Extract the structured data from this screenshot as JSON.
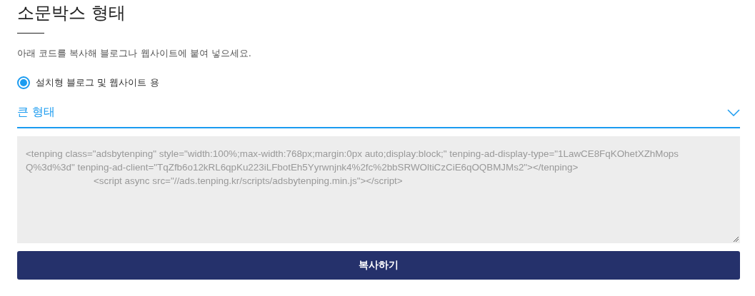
{
  "title": "소문박스 형태",
  "description": "아래 코드를 복사해 블로그나 웹사이트에 붙여 넣으세요.",
  "options": [
    {
      "label": "설치형 블로그 및 웹사이트 용",
      "selected": true
    }
  ],
  "dropdown": {
    "value": "큰 형태"
  },
  "code_box": {
    "lines": [
      {
        "text": "<tenping class=\"adsbytenping\" style=\"width:100%;max-width:768px;margin:0px auto;display:block;\" tenping-ad-display-type=\"1LawCE8FqKOhetXZhMops",
        "indented": false
      },
      {
        "text": "Q%3d%3d\" tenping-ad-client=\"TqZfb6o12kRL6qpKu223iLFbotEh5Yyrwnjnk4%2fc%2bbSRWOltiCzCiE6qOQBMJMs2\"></tenping>",
        "indented": false
      },
      {
        "text": "<script async src=\"//ads.tenping.kr/scripts/adsbytenping.min.js\"></script>",
        "indented": true
      }
    ]
  },
  "copy_button": {
    "label": "복사하기"
  }
}
